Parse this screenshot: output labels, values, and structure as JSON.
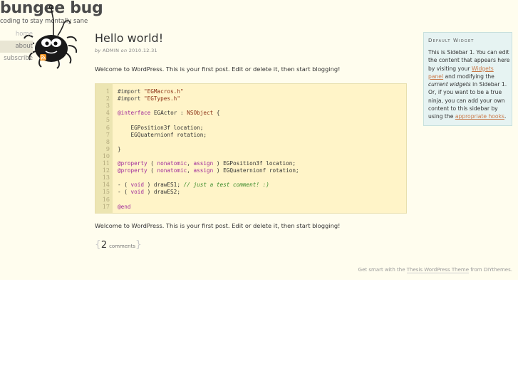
{
  "site": {
    "title": "bungee bug",
    "tagline": "coding to stay mentally sane"
  },
  "nav": {
    "items": [
      {
        "label": "home"
      },
      {
        "label": "about"
      },
      {
        "label": "subscribe"
      }
    ]
  },
  "post": {
    "title": "Hello world!",
    "byline_prefix": "by",
    "author": "ADMIN",
    "date_prefix": "on",
    "date": "2010.12.31",
    "intro": "Welcome to WordPress. This is your first post. Edit or delete it, then start blogging!",
    "outro": "Welcome to WordPress. This is your first post. Edit or delete it, then start blogging!",
    "comment_count": "2",
    "comment_word": "comments",
    "brace_open": "{",
    "brace_close": "}"
  },
  "code": {
    "line_numbers": [
      "1",
      "2",
      "3",
      "4",
      "5",
      "6",
      "7",
      "8",
      "9",
      "10",
      "11",
      "12",
      "13",
      "14",
      "15",
      "16",
      "17"
    ],
    "lines": [
      [
        {
          "t": "#import ",
          "c": "pp"
        },
        {
          "t": "\"EGMacros.h\"",
          "c": "str"
        }
      ],
      [
        {
          "t": "#import ",
          "c": "pp"
        },
        {
          "t": "\"EGTypes.h\"",
          "c": "str"
        }
      ],
      [],
      [
        {
          "t": "@interface",
          "c": "kw"
        },
        {
          "t": " EGActor : ",
          "c": ""
        },
        {
          "t": "NSObject",
          "c": "cls"
        },
        {
          "t": " {",
          "c": ""
        }
      ],
      [],
      [
        {
          "t": "    EGPosition3f location;",
          "c": ""
        }
      ],
      [
        {
          "t": "    EGQuaternionf rotation;",
          "c": ""
        }
      ],
      [],
      [
        {
          "t": "}",
          "c": ""
        }
      ],
      [],
      [
        {
          "t": "@property",
          "c": "kw"
        },
        {
          "t": " ( ",
          "c": ""
        },
        {
          "t": "nonatomic",
          "c": "kw"
        },
        {
          "t": ", ",
          "c": ""
        },
        {
          "t": "assign",
          "c": "kw"
        },
        {
          "t": " ) EGPosition3f location;",
          "c": ""
        }
      ],
      [
        {
          "t": "@property",
          "c": "kw"
        },
        {
          "t": " ( ",
          "c": ""
        },
        {
          "t": "nonatomic",
          "c": "kw"
        },
        {
          "t": ", ",
          "c": ""
        },
        {
          "t": "assign",
          "c": "kw"
        },
        {
          "t": " ) EGQuaternionf rotation;",
          "c": ""
        }
      ],
      [],
      [
        {
          "t": "- ( ",
          "c": ""
        },
        {
          "t": "void",
          "c": "kw"
        },
        {
          "t": " ) drawES1; ",
          "c": ""
        },
        {
          "t": "// just a test comment! :)",
          "c": "cmt"
        }
      ],
      [
        {
          "t": "- ( ",
          "c": ""
        },
        {
          "t": "void",
          "c": "kw"
        },
        {
          "t": " ) drawES2;",
          "c": ""
        }
      ],
      [],
      [
        {
          "t": "@end",
          "c": "kw"
        }
      ]
    ]
  },
  "widget": {
    "title": "Default Widget",
    "t1": "This is Sidebar 1. You can edit the content that appears here by visiting your ",
    "link1": "Widgets panel",
    "t2": " and modifying the ",
    "em1": "current widgets",
    "t3": " in Sidebar 1. Or, if you want to be a true ninja, you can add your own content to this sidebar by using the ",
    "link2": "appropriate hooks",
    "t4": "."
  },
  "footer": {
    "prefix": "Get smart with the ",
    "link": "Thesis WordPress Theme",
    "suffix": " from DIYthemes."
  }
}
